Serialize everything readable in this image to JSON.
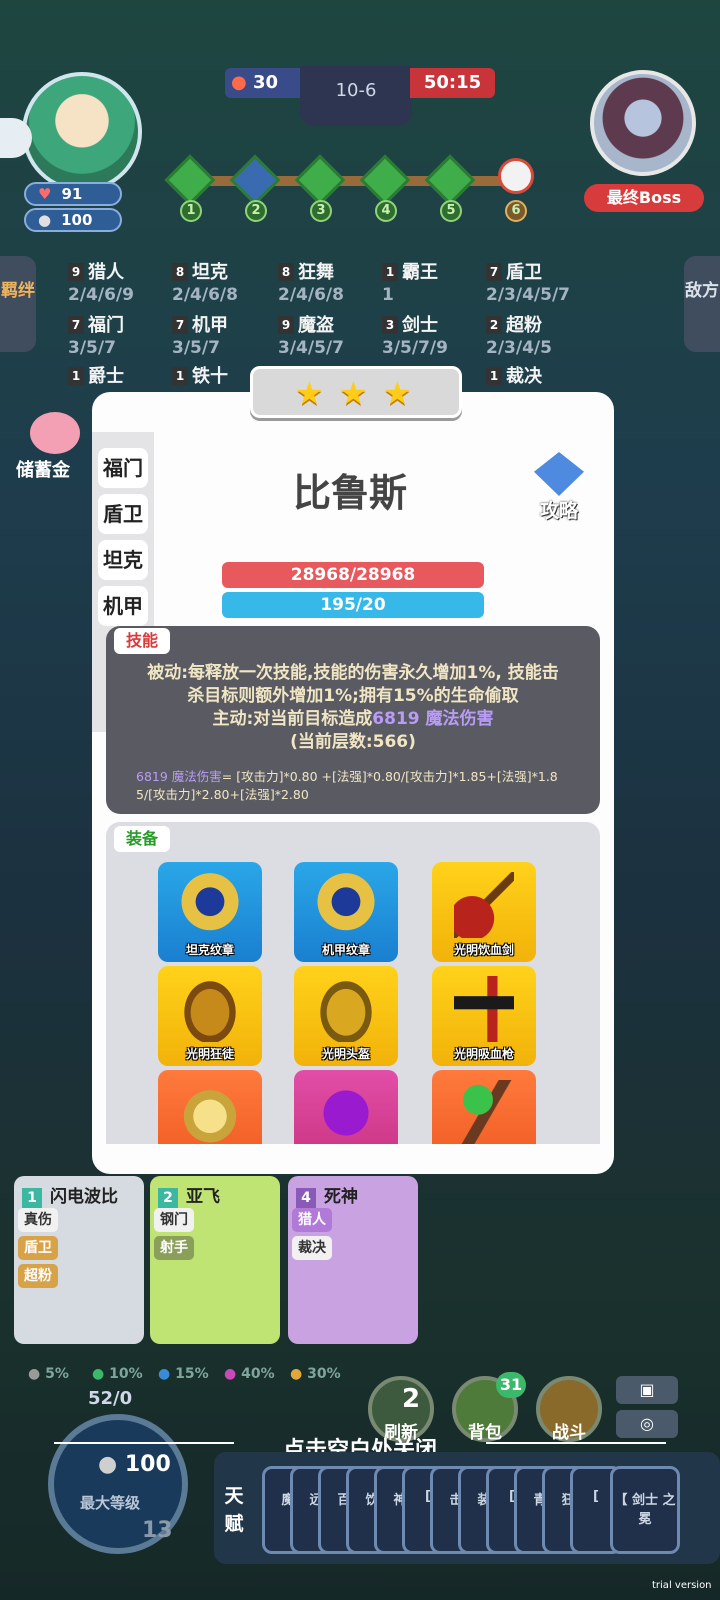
{
  "hud": {
    "player": {
      "hp": "91",
      "gold": "100"
    },
    "round": {
      "score": "30",
      "stage": "10-6",
      "timer": "50:15"
    },
    "boss_label": "最终Boss",
    "stages": [
      "1",
      "2",
      "3",
      "4",
      "5",
      "6"
    ]
  },
  "side_tabs": {
    "left": "羁绊",
    "right": "敌方"
  },
  "synergies": [
    {
      "count": "9",
      "name": "猎人",
      "levels": "2/4/6/9"
    },
    {
      "count": "8",
      "name": "坦克",
      "levels": "2/4/6/8"
    },
    {
      "count": "8",
      "name": "狂舞",
      "levels": "2/4/6/8"
    },
    {
      "count": "1",
      "name": "霸王",
      "levels": "1"
    },
    {
      "count": "7",
      "name": "盾卫",
      "levels": "2/3/4/5/7"
    },
    {
      "count": "7",
      "name": "福门",
      "levels": "3/5/7"
    },
    {
      "count": "7",
      "name": "机甲",
      "levels": "3/5/7"
    },
    {
      "count": "9",
      "name": "魔盗",
      "levels": "3/4/5/7"
    },
    {
      "count": "3",
      "name": "剑士",
      "levels": "3/5/7/9"
    },
    {
      "count": "2",
      "name": "超粉",
      "levels": "2/3/4/5"
    }
  ],
  "synergy_partial": [
    {
      "count": "1",
      "name": "爵士"
    },
    {
      "count": "1",
      "name": "铁十"
    },
    {
      "count": "1",
      "name": "裁决"
    }
  ],
  "piggy_label": "储蓄金",
  "modal": {
    "stars": 3,
    "categories": [
      "福门",
      "盾卫",
      "坦克",
      "机甲"
    ],
    "hero_name": "比鲁斯",
    "strategy_label": "攻略",
    "hp": "28968/28968",
    "mana": "195/20",
    "skill_tag": "技能",
    "skill_lines": [
      "被动:每释放一次技能,技能的伤害永久增加1%, 技能击",
      "杀目标则额外增加1%;拥有15%的生命偷取"
    ],
    "skill_active_prefix": "主动:对当前目标造成",
    "skill_active_dmg": "6819 魔法伤害",
    "skill_active_stack": "(当前层数:566)",
    "formula_dmg": "6819 魔法伤害",
    "formula_rest": "= [攻击力]*0.80 +[法强]*0.80/[攻击力]*1.85+[法强]*1.8",
    "formula_line2": "5/[攻击力]*2.80+[法强]*2.80",
    "equip_tag": "装备",
    "equipment": [
      {
        "name": "坦克纹章",
        "color": "blue",
        "icon": "emblem-icon"
      },
      {
        "name": "机甲纹章",
        "color": "blue",
        "icon": "emblem-icon"
      },
      {
        "name": "光明饮血剑",
        "color": "gold",
        "icon": "scythe-icon"
      },
      {
        "name": "光明狂徒",
        "color": "gold",
        "icon": "armor-icon"
      },
      {
        "name": "光明头盔",
        "color": "gold",
        "icon": "helmet-icon"
      },
      {
        "name": "光明吸血枪",
        "color": "gold",
        "icon": "gun-icon"
      },
      {
        "name": "",
        "color": "orange",
        "icon": "orb-icon"
      },
      {
        "name": "",
        "color": "purple",
        "icon": "gem-icon"
      },
      {
        "name": "",
        "color": "orange",
        "icon": "staff-icon"
      }
    ]
  },
  "shop": [
    {
      "cost": "1",
      "name": "闪电波比",
      "traits": [
        "真伤",
        "盾卫",
        "超粉"
      ]
    },
    {
      "cost": "2",
      "name": "亚飞",
      "traits": [
        "钢门",
        "射手"
      ]
    },
    {
      "cost": "4",
      "name": "死神",
      "traits": [
        "猎人",
        "裁决"
      ]
    }
  ],
  "odds": [
    "5%",
    "10%",
    "15%",
    "40%",
    "30%"
  ],
  "level": {
    "exp": "52/0",
    "gold": "100",
    "label": "最大等级",
    "lv": "13"
  },
  "actions": {
    "refresh_cost": "2",
    "refresh": "刷新",
    "bag": "背包",
    "bag_count": "31",
    "battle": "战斗"
  },
  "close_hint": "点击空白处关闭",
  "talent": {
    "label": "天赋",
    "cards": [
      "魔",
      "远",
      "百",
      "饮",
      "神",
      "[",
      "击",
      "装",
      "[",
      "青",
      "狂",
      "["
    ],
    "last_card": "【 剑士 之冕"
  },
  "watermark": "trial version"
}
